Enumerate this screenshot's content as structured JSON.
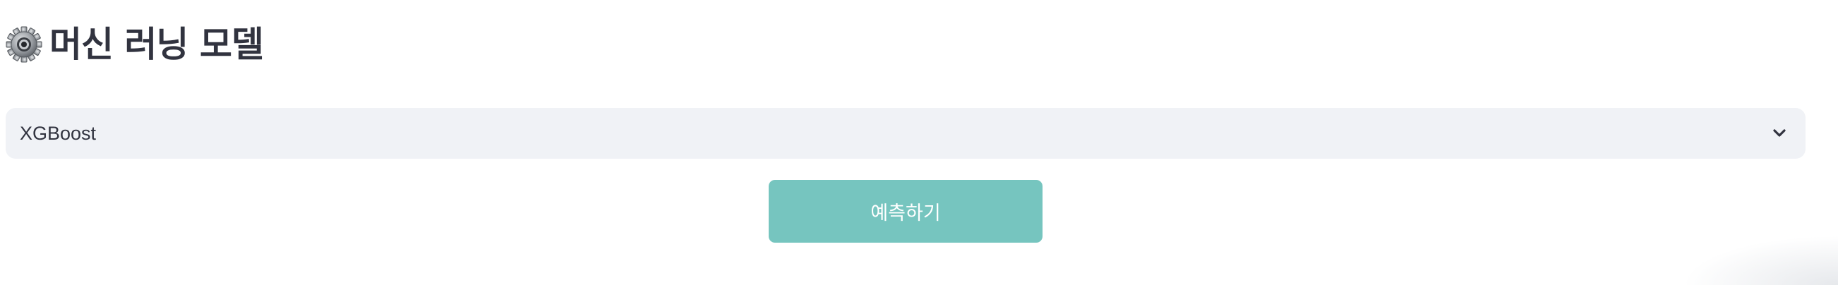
{
  "header": {
    "icon": "gear-icon",
    "title": "머신 러닝 모델"
  },
  "model_select": {
    "selected_value": "XGBoost",
    "icon": "chevron-down-icon"
  },
  "predict_button": {
    "label": "예측하기",
    "color": "#76c5bf"
  },
  "colors": {
    "select_background": "#f0f2f6",
    "text": "#31333f"
  }
}
